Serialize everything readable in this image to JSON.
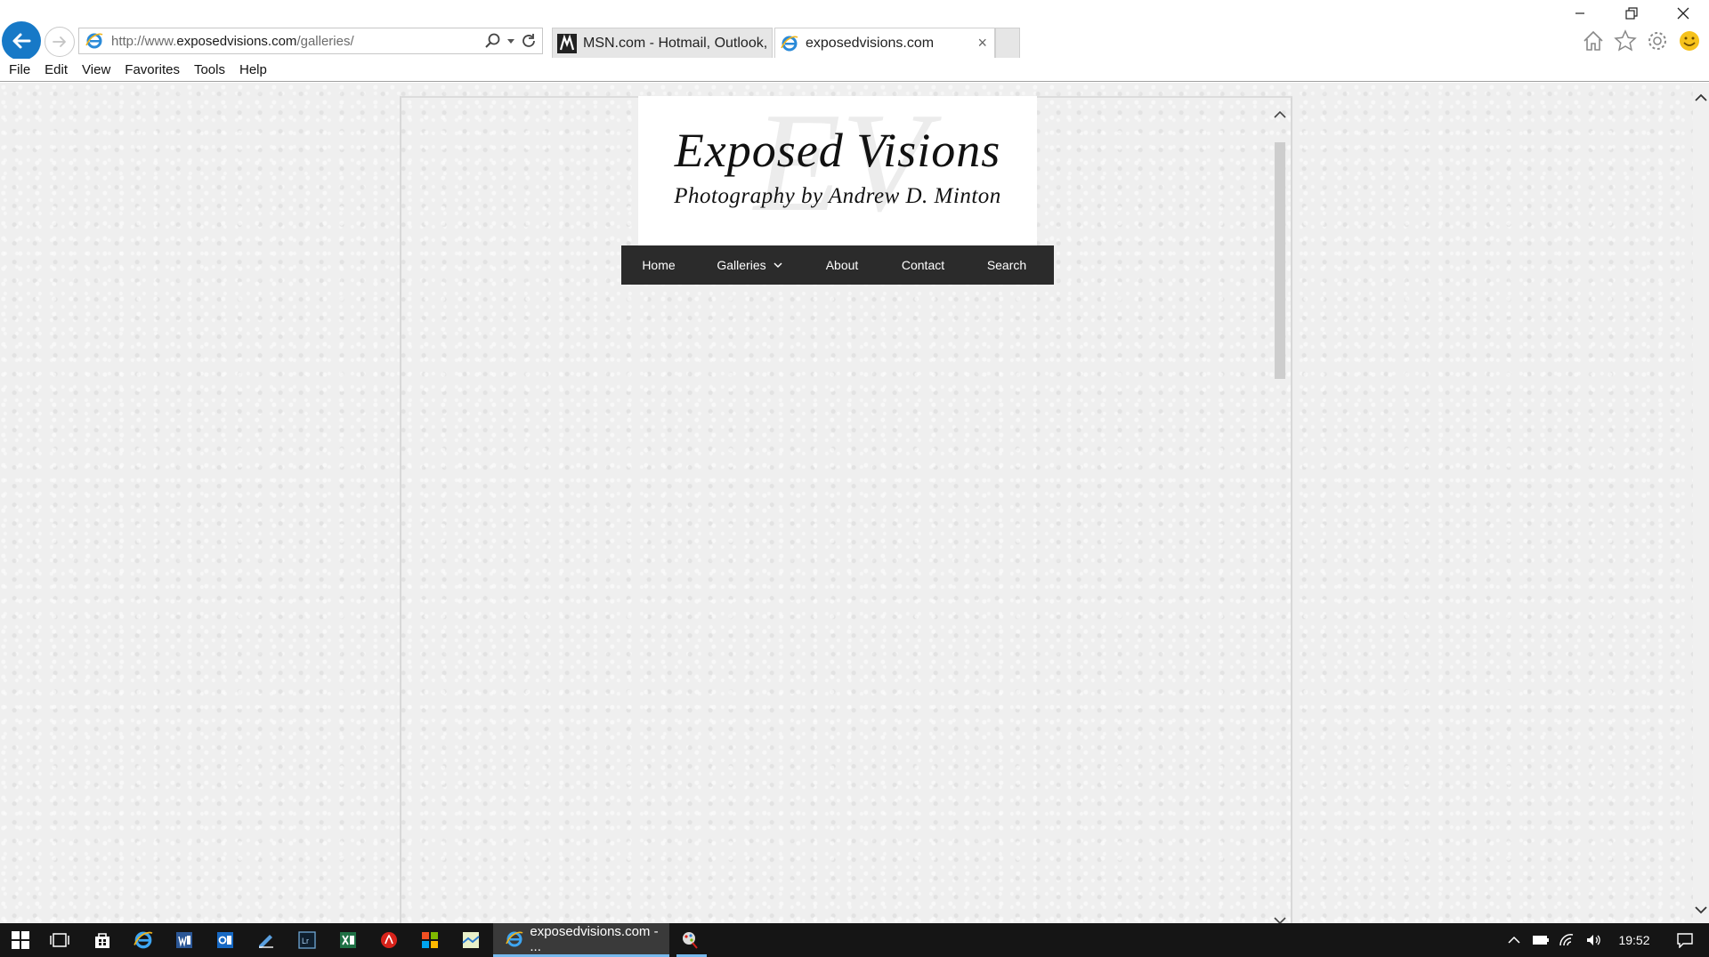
{
  "browser": {
    "address": {
      "url_prefix": "http://www.",
      "url_host": "exposedvisions.com",
      "url_path": "/galleries/"
    },
    "tabs": [
      {
        "label": "MSN.com - Hotmail, Outlook, ...",
        "active": false
      },
      {
        "label": "exposedvisions.com",
        "active": true
      }
    ],
    "tab_close": "×",
    "menu": [
      "File",
      "Edit",
      "View",
      "Favorites",
      "Tools",
      "Help"
    ]
  },
  "site": {
    "logo_monogram": "EV",
    "logo_title": "Exposed Visions",
    "logo_subtitle": "Photography by Andrew D. Minton",
    "nav": [
      {
        "label": "Home"
      },
      {
        "label": "Galleries",
        "has_dropdown": true
      },
      {
        "label": "About"
      },
      {
        "label": "Contact"
      },
      {
        "label": "Search"
      }
    ]
  },
  "taskbar": {
    "active_window_label": "exposedvisions.com - ...",
    "clock": "19:52"
  },
  "colors": {
    "back_button": "#1779c7",
    "nav_background": "#2b2b2b",
    "page_background": "#efefef",
    "taskbar": "#151515",
    "taskbar_accent": "#76b9ed"
  }
}
